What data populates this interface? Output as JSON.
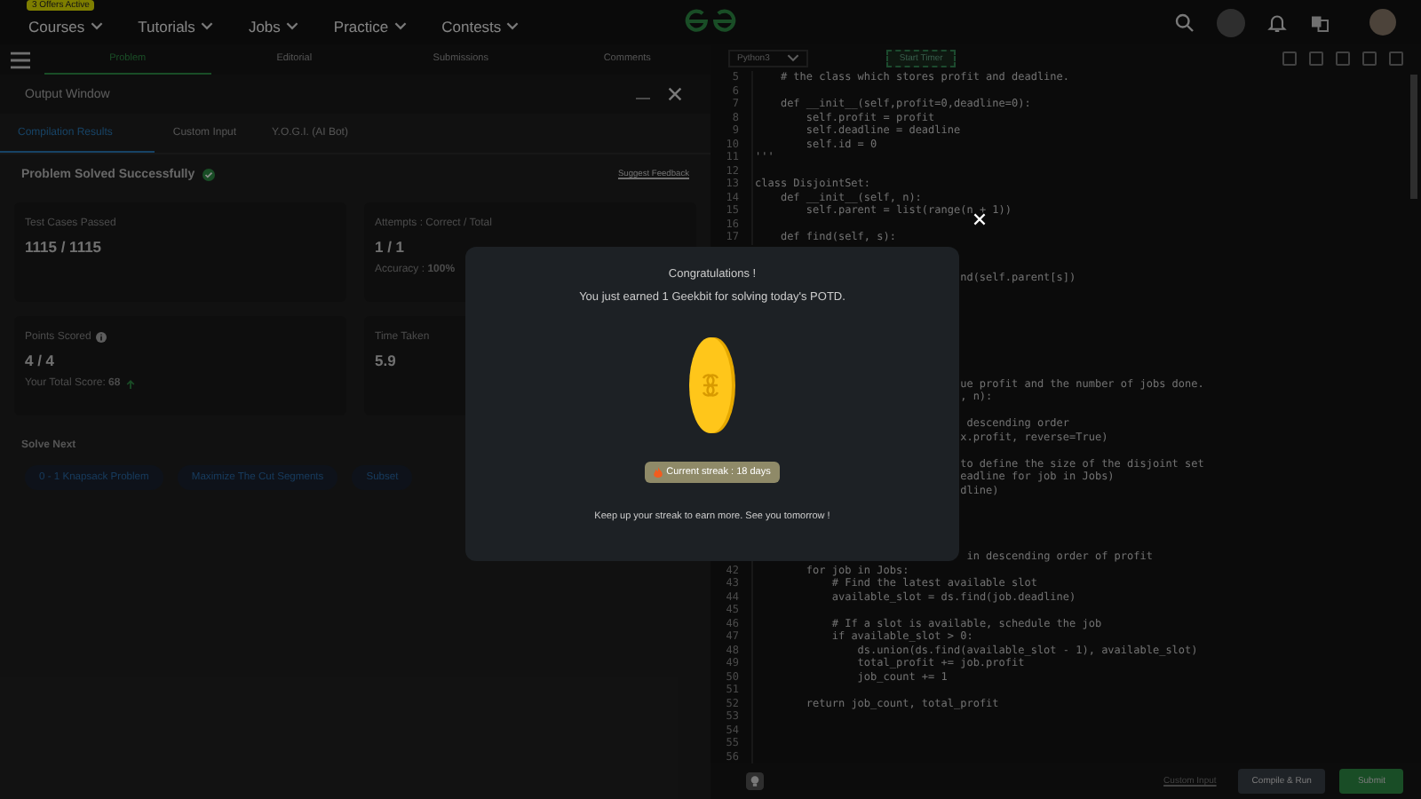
{
  "nav": {
    "offer_badge": "3 Offers Active",
    "menu": [
      "Courses",
      "Tutorials",
      "Jobs",
      "Practice",
      "Contests"
    ]
  },
  "problem_tabs": [
    {
      "label": "Problem",
      "selected": true
    },
    {
      "label": "Editorial",
      "selected": false
    },
    {
      "label": "Submissions",
      "selected": false
    },
    {
      "label": "Comments",
      "selected": false
    }
  ],
  "output_window": {
    "title": "Output Window",
    "tabs": [
      {
        "label": "Compilation Results",
        "selected": true
      },
      {
        "label": "Custom Input",
        "selected": false
      },
      {
        "label": "Y.O.G.I. (AI Bot)",
        "selected": false
      }
    ],
    "status": "Problem Solved Successfully",
    "feedback_link": "Suggest Feedback",
    "stats": [
      {
        "label": "Test Cases Passed",
        "value": "1115 / 1115"
      },
      {
        "label": "Attempts : Correct / Total",
        "value": "1 / 1",
        "note": "Accuracy : **100%**"
      },
      {
        "label": "Points Scored",
        "value": "4 / 4",
        "note": "Your Total Score: **68**",
        "info": true,
        "trend_up": true
      },
      {
        "label": "Time Taken",
        "value": "5.9"
      }
    ],
    "solve_next": {
      "title": "Solve Next",
      "items": [
        "0 - 1 Knapsack Problem",
        "Maximize The Cut Segments",
        "Subset"
      ]
    }
  },
  "editor": {
    "language": "Python3",
    "timer_button": "Start Timer",
    "lines": [
      {
        "num": "5",
        "text": "    # the class which stores profit and deadline."
      },
      {
        "num": "6"
      },
      {
        "num": "7",
        "text": "    def __init__(self,profit=0,deadline=0):"
      },
      {
        "num": "8",
        "text": "        self.profit = profit"
      },
      {
        "num": "9",
        "text": "        self.deadline = deadline"
      },
      {
        "num": "10",
        "text": "        self.id = 0"
      },
      {
        "num": "11",
        "text": "'''"
      },
      {
        "num": "12"
      },
      {
        "num": "13",
        "text": "class DisjointSet:"
      },
      {
        "num": "14",
        "text": "    def __init__(self, n):"
      },
      {
        "num": "15",
        "text": "        self.parent = list(range(n + 1))"
      },
      {
        "num": "16"
      },
      {
        "num": "17",
        "text": "    def find(self, s):"
      },
      {
        "kind": "blank"
      },
      {
        "kind": "blank"
      },
      {
        "text": "                                nd(self.parent[s])"
      },
      {
        "kind": "blank"
      },
      {
        "kind": "blank"
      },
      {
        "kind": "blank"
      },
      {
        "kind": "blank"
      },
      {
        "kind": "blank"
      },
      {
        "kind": "blank"
      },
      {
        "kind": "blank"
      },
      {
        "text": "                                ue profit and the number of jobs done."
      },
      {
        "text": "                                , n):"
      },
      {
        "kind": "blank"
      },
      {
        "text": "                                 descending order"
      },
      {
        "text": "                                x.profit, reverse=True)"
      },
      {
        "kind": "blank"
      },
      {
        "text": "                                to define the size of the disjoint set"
      },
      {
        "text": "                                eadline for job in Jobs)"
      },
      {
        "text": "                                dline)"
      },
      {
        "kind": "blank"
      },
      {
        "kind": "blank"
      },
      {
        "kind": "blank"
      },
      {
        "kind": "blank"
      },
      {
        "text": "                                 in descending order of profit"
      },
      {
        "num": "42",
        "text": "        for job in Jobs:"
      },
      {
        "num": "43",
        "text": "            # Find the latest available slot"
      },
      {
        "num": "44",
        "text": "            available_slot = ds.find(job.deadline)"
      },
      {
        "num": "45"
      },
      {
        "num": "46",
        "text": "            # If a slot is available, schedule the job"
      },
      {
        "num": "47",
        "text": "            if available_slot > 0:"
      },
      {
        "num": "48",
        "text": "                ds.union(ds.find(available_slot - 1), available_slot)"
      },
      {
        "num": "49",
        "text": "                total_profit += job.profit"
      },
      {
        "num": "50",
        "text": "                job_count += 1"
      },
      {
        "num": "51"
      },
      {
        "num": "52",
        "text": "        return job_count, total_profit"
      },
      {
        "num": "53"
      },
      {
        "num": "54"
      },
      {
        "num": "55"
      },
      {
        "num": "56"
      }
    ],
    "custom_input": "Custom Input",
    "compile_button": "Compile & Run",
    "submit_button": "Submit"
  },
  "modal": {
    "title": "Congratulations !",
    "message": "You just earned 1 Geekbit for solving today's POTD.",
    "streak": "Current streak : 18 days",
    "footer": "Keep up your streak to earn more. See you tomorrow !"
  }
}
